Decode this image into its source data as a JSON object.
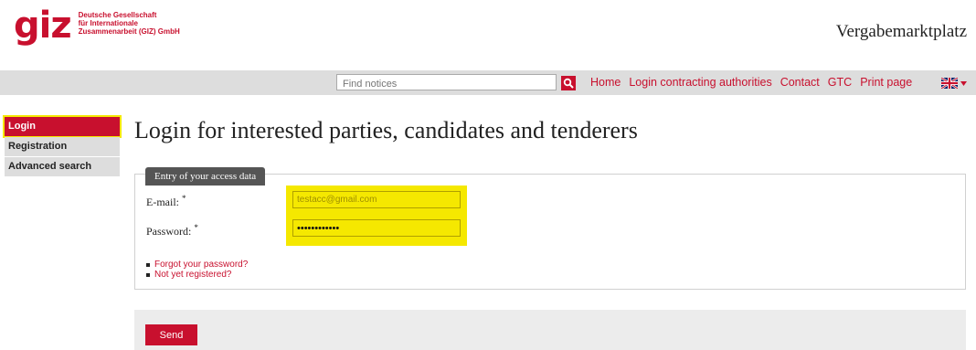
{
  "header": {
    "logo_mark": "giz",
    "logo_lines": [
      "Deutsche Gesellschaft",
      "für Internationale",
      "Zusammenarbeit (GIZ) GmbH"
    ],
    "site_title": "Vergabemarktplatz"
  },
  "navbar": {
    "search_placeholder": "Find notices",
    "search_icon": "search-icon",
    "links": [
      "Home",
      "Login contracting authorities",
      "Contact",
      "GTC",
      "Print page"
    ],
    "language_icon": "uk-flag-icon"
  },
  "sidebar": {
    "items": [
      {
        "label": "Login",
        "active": true
      },
      {
        "label": "Registration",
        "active": false
      },
      {
        "label": "Advanced search",
        "active": false
      }
    ]
  },
  "main": {
    "title": "Login for interested parties, candidates and tenderers",
    "fieldset_legend": "Entry of your access data",
    "email_label": "E-mail:",
    "password_label": "Password:",
    "required_mark": "*",
    "email_value": "testacc@gmail.com",
    "password_value": "••••••••••••",
    "links": [
      "Forgot your password?",
      "Not yet registered?"
    ],
    "send_label": "Send"
  },
  "colors": {
    "brand_red": "#c8102e",
    "highlight_yellow": "#f5e800",
    "nav_gray": "#dddddd"
  }
}
